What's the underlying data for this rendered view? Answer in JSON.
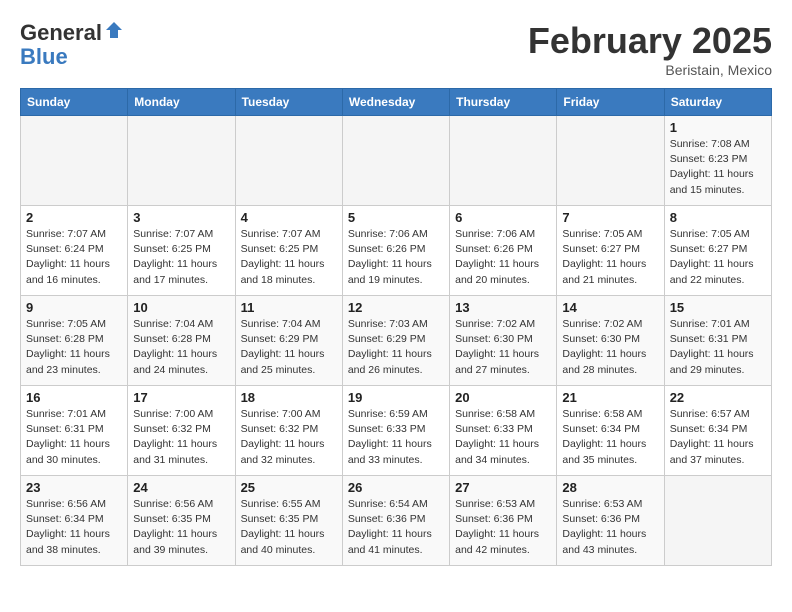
{
  "header": {
    "logo_general": "General",
    "logo_blue": "Blue",
    "title": "February 2025",
    "subtitle": "Beristain, Mexico"
  },
  "calendar": {
    "days_of_week": [
      "Sunday",
      "Monday",
      "Tuesday",
      "Wednesday",
      "Thursday",
      "Friday",
      "Saturday"
    ],
    "weeks": [
      [
        {
          "day": "",
          "info": ""
        },
        {
          "day": "",
          "info": ""
        },
        {
          "day": "",
          "info": ""
        },
        {
          "day": "",
          "info": ""
        },
        {
          "day": "",
          "info": ""
        },
        {
          "day": "",
          "info": ""
        },
        {
          "day": "1",
          "info": "Sunrise: 7:08 AM\nSunset: 6:23 PM\nDaylight: 11 hours\nand 15 minutes."
        }
      ],
      [
        {
          "day": "2",
          "info": "Sunrise: 7:07 AM\nSunset: 6:24 PM\nDaylight: 11 hours\nand 16 minutes."
        },
        {
          "day": "3",
          "info": "Sunrise: 7:07 AM\nSunset: 6:25 PM\nDaylight: 11 hours\nand 17 minutes."
        },
        {
          "day": "4",
          "info": "Sunrise: 7:07 AM\nSunset: 6:25 PM\nDaylight: 11 hours\nand 18 minutes."
        },
        {
          "day": "5",
          "info": "Sunrise: 7:06 AM\nSunset: 6:26 PM\nDaylight: 11 hours\nand 19 minutes."
        },
        {
          "day": "6",
          "info": "Sunrise: 7:06 AM\nSunset: 6:26 PM\nDaylight: 11 hours\nand 20 minutes."
        },
        {
          "day": "7",
          "info": "Sunrise: 7:05 AM\nSunset: 6:27 PM\nDaylight: 11 hours\nand 21 minutes."
        },
        {
          "day": "8",
          "info": "Sunrise: 7:05 AM\nSunset: 6:27 PM\nDaylight: 11 hours\nand 22 minutes."
        }
      ],
      [
        {
          "day": "9",
          "info": "Sunrise: 7:05 AM\nSunset: 6:28 PM\nDaylight: 11 hours\nand 23 minutes."
        },
        {
          "day": "10",
          "info": "Sunrise: 7:04 AM\nSunset: 6:28 PM\nDaylight: 11 hours\nand 24 minutes."
        },
        {
          "day": "11",
          "info": "Sunrise: 7:04 AM\nSunset: 6:29 PM\nDaylight: 11 hours\nand 25 minutes."
        },
        {
          "day": "12",
          "info": "Sunrise: 7:03 AM\nSunset: 6:29 PM\nDaylight: 11 hours\nand 26 minutes."
        },
        {
          "day": "13",
          "info": "Sunrise: 7:02 AM\nSunset: 6:30 PM\nDaylight: 11 hours\nand 27 minutes."
        },
        {
          "day": "14",
          "info": "Sunrise: 7:02 AM\nSunset: 6:30 PM\nDaylight: 11 hours\nand 28 minutes."
        },
        {
          "day": "15",
          "info": "Sunrise: 7:01 AM\nSunset: 6:31 PM\nDaylight: 11 hours\nand 29 minutes."
        }
      ],
      [
        {
          "day": "16",
          "info": "Sunrise: 7:01 AM\nSunset: 6:31 PM\nDaylight: 11 hours\nand 30 minutes."
        },
        {
          "day": "17",
          "info": "Sunrise: 7:00 AM\nSunset: 6:32 PM\nDaylight: 11 hours\nand 31 minutes."
        },
        {
          "day": "18",
          "info": "Sunrise: 7:00 AM\nSunset: 6:32 PM\nDaylight: 11 hours\nand 32 minutes."
        },
        {
          "day": "19",
          "info": "Sunrise: 6:59 AM\nSunset: 6:33 PM\nDaylight: 11 hours\nand 33 minutes."
        },
        {
          "day": "20",
          "info": "Sunrise: 6:58 AM\nSunset: 6:33 PM\nDaylight: 11 hours\nand 34 minutes."
        },
        {
          "day": "21",
          "info": "Sunrise: 6:58 AM\nSunset: 6:34 PM\nDaylight: 11 hours\nand 35 minutes."
        },
        {
          "day": "22",
          "info": "Sunrise: 6:57 AM\nSunset: 6:34 PM\nDaylight: 11 hours\nand 37 minutes."
        }
      ],
      [
        {
          "day": "23",
          "info": "Sunrise: 6:56 AM\nSunset: 6:34 PM\nDaylight: 11 hours\nand 38 minutes."
        },
        {
          "day": "24",
          "info": "Sunrise: 6:56 AM\nSunset: 6:35 PM\nDaylight: 11 hours\nand 39 minutes."
        },
        {
          "day": "25",
          "info": "Sunrise: 6:55 AM\nSunset: 6:35 PM\nDaylight: 11 hours\nand 40 minutes."
        },
        {
          "day": "26",
          "info": "Sunrise: 6:54 AM\nSunset: 6:36 PM\nDaylight: 11 hours\nand 41 minutes."
        },
        {
          "day": "27",
          "info": "Sunrise: 6:53 AM\nSunset: 6:36 PM\nDaylight: 11 hours\nand 42 minutes."
        },
        {
          "day": "28",
          "info": "Sunrise: 6:53 AM\nSunset: 6:36 PM\nDaylight: 11 hours\nand 43 minutes."
        },
        {
          "day": "",
          "info": ""
        }
      ]
    ]
  }
}
